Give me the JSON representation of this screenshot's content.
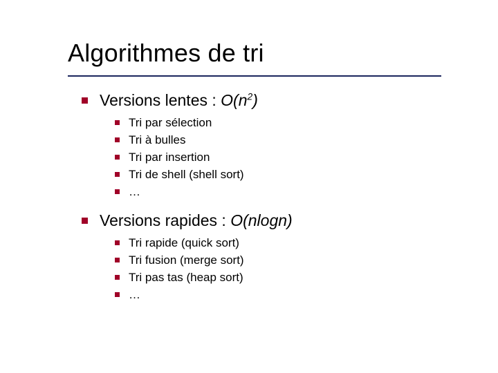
{
  "title": "Algorithmes de tri",
  "sections": [
    {
      "label_plain": "Versions lentes : ",
      "complexity_base": "O(n",
      "complexity_exp": "2",
      "complexity_tail": ")",
      "items": [
        "Tri par sélection",
        "Tri à bulles",
        "Tri par insertion",
        "Tri de shell (shell sort)",
        "…"
      ]
    },
    {
      "label_plain": "Versions rapides : ",
      "complexity_base": "O(nlogn)",
      "complexity_exp": "",
      "complexity_tail": "",
      "items": [
        "Tri rapide (quick sort)",
        "Tri fusion (merge sort)",
        "Tri pas tas (heap sort)",
        "…"
      ]
    }
  ]
}
